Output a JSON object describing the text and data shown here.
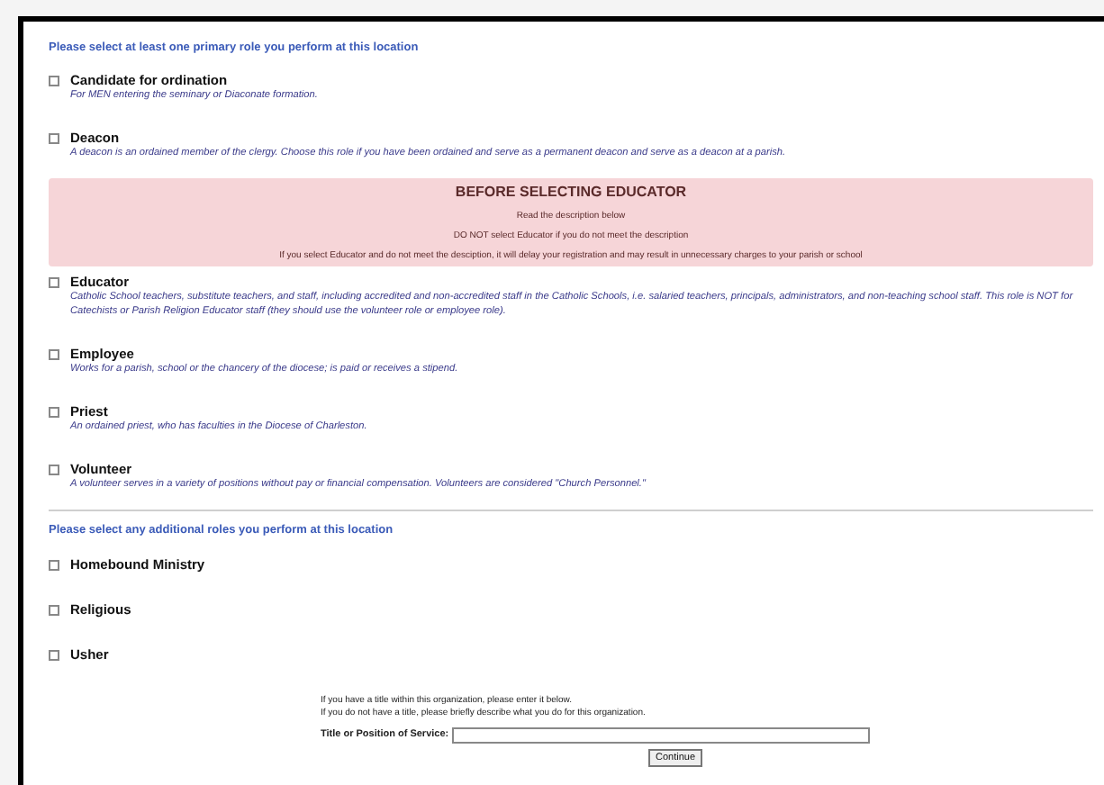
{
  "primary_prompt": "Please select at least one primary role you perform at this location",
  "primary_roles": [
    {
      "kind": "role",
      "title": "Candidate for ordination",
      "description": "For MEN entering the seminary or Diaconate formation.",
      "checked": false
    },
    {
      "kind": "role",
      "title": "Deacon",
      "description": "A deacon is an ordained member of the clergy. Choose this role if you have been ordained and serve as a permanent deacon and serve as a deacon at a parish.",
      "checked": false
    },
    {
      "kind": "warning",
      "heading": "BEFORE SELECTING EDUCATOR",
      "lines": [
        "Read the description below",
        "DO NOT select Educator if you do not meet the description",
        "If you select Educator and do not meet the desciption, it will delay your registration and may result in unnecessary charges to your parish or school"
      ]
    },
    {
      "kind": "role",
      "title": "Educator",
      "description": "Catholic School teachers, substitute teachers, and staff, including accredited and non-accredited staff in the Catholic Schools, i.e. salaried teachers, principals, administrators, and non-teaching school staff. This role is NOT for Catechists or Parish Religion Educator staff (they should use the volunteer role or employee role).",
      "checked": false
    },
    {
      "kind": "role",
      "title": "Employee",
      "description": "Works for a parish, school or the chancery of the diocese; is paid or receives a stipend.",
      "checked": false
    },
    {
      "kind": "role",
      "title": "Priest",
      "description": "An ordained priest, who has faculties in the Diocese of Charleston.",
      "checked": false
    },
    {
      "kind": "role",
      "title": "Volunteer",
      "description": "A volunteer serves in a variety of positions without pay or financial compensation. Volunteers are considered \"Church Personnel.\"",
      "checked": false
    }
  ],
  "additional_prompt": "Please select any additional roles you perform at this location",
  "additional_roles": [
    {
      "title": "Homebound Ministry",
      "checked": false
    },
    {
      "title": "Religious",
      "checked": false
    },
    {
      "title": "Usher",
      "checked": false
    }
  ],
  "title_note": [
    "If you have a title within this organization, please enter it below.",
    "If you do not have a title, please briefly describe what you do for this organization."
  ],
  "title_field": {
    "label": "Title or Position of Service:"
  },
  "continue_button": "Continue"
}
